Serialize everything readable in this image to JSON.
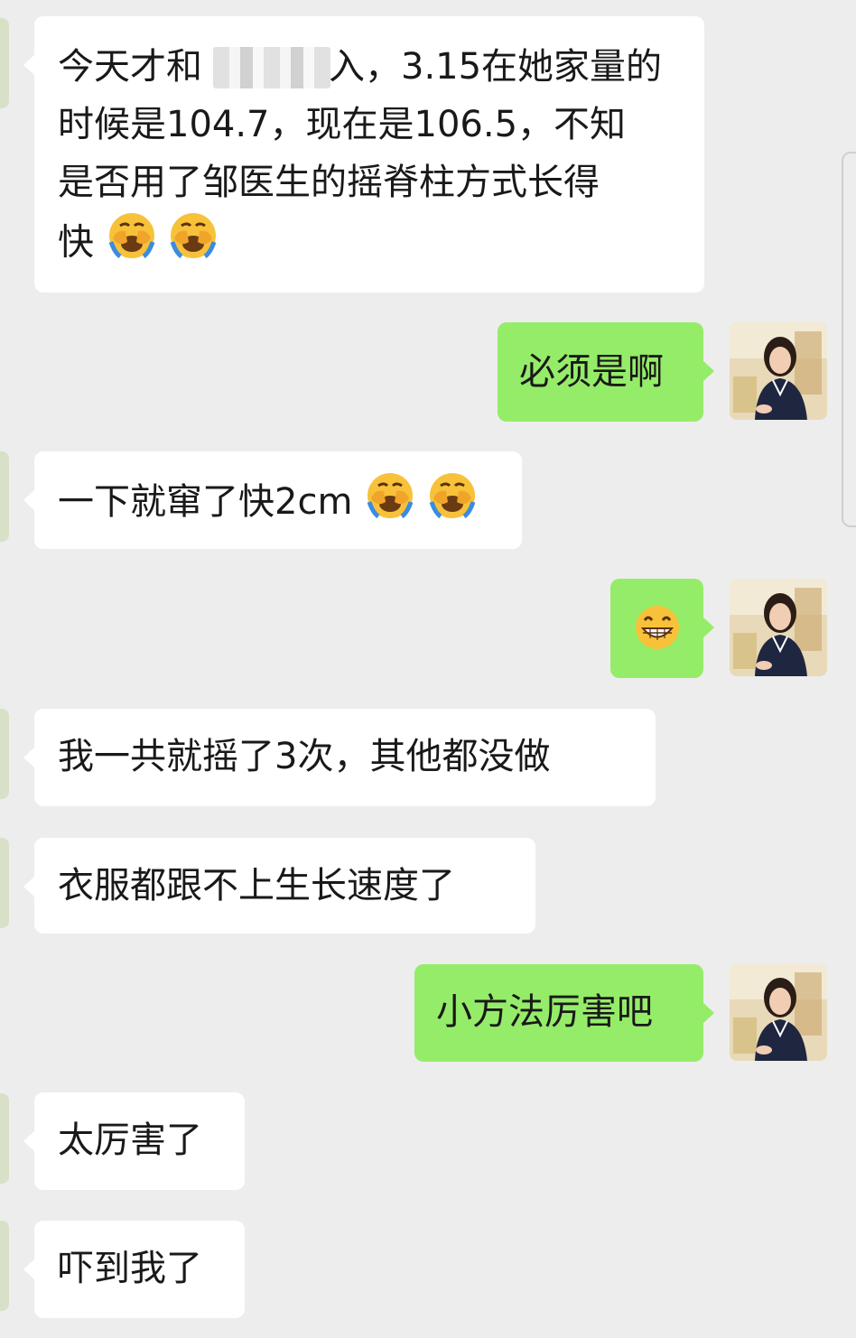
{
  "messages": [
    {
      "id": 1,
      "side": "in",
      "text": "今天才和",
      "text_after": "入，3.15在她家量的时候是104.7，现在是106.5，不知是否用了邹医生的摇脊柱方式长得快",
      "emojis": [
        "loudly-crying-face",
        "loudly-crying-face"
      ]
    },
    {
      "id": 2,
      "side": "out",
      "text": "必须是啊",
      "emojis": []
    },
    {
      "id": 3,
      "side": "in",
      "text": "一下就窜了快2cm",
      "emojis": [
        "loudly-crying-face",
        "loudly-crying-face"
      ]
    },
    {
      "id": 4,
      "side": "out",
      "text": "",
      "emojis": [
        "grinning-face"
      ]
    },
    {
      "id": 5,
      "side": "in",
      "text": "我一共就摇了3次，其他都没做",
      "emojis": []
    },
    {
      "id": 6,
      "side": "in",
      "text": "衣服都跟不上生长速度了",
      "emojis": []
    },
    {
      "id": 7,
      "side": "out",
      "text": "小方法厉害吧",
      "emojis": []
    },
    {
      "id": 8,
      "side": "in",
      "text": "太厉害了",
      "emojis": []
    },
    {
      "id": 9,
      "side": "in",
      "text": "吓到我了",
      "emojis": []
    }
  ],
  "lines_msg1": [
    "今天才和",
    "入，3.15在她家量的",
    "时候是104.7，现在是106.5，不知",
    "是否用了邹医生的摇脊柱方式长得",
    "快"
  ],
  "colors": {
    "background": "#ededed",
    "incoming_bubble": "#ffffff",
    "outgoing_bubble": "#95ec69",
    "text": "#191919"
  },
  "icons": {
    "cry": "loudly-crying-face",
    "grin": "grinning-face",
    "avatar": "user-avatar-photo"
  }
}
